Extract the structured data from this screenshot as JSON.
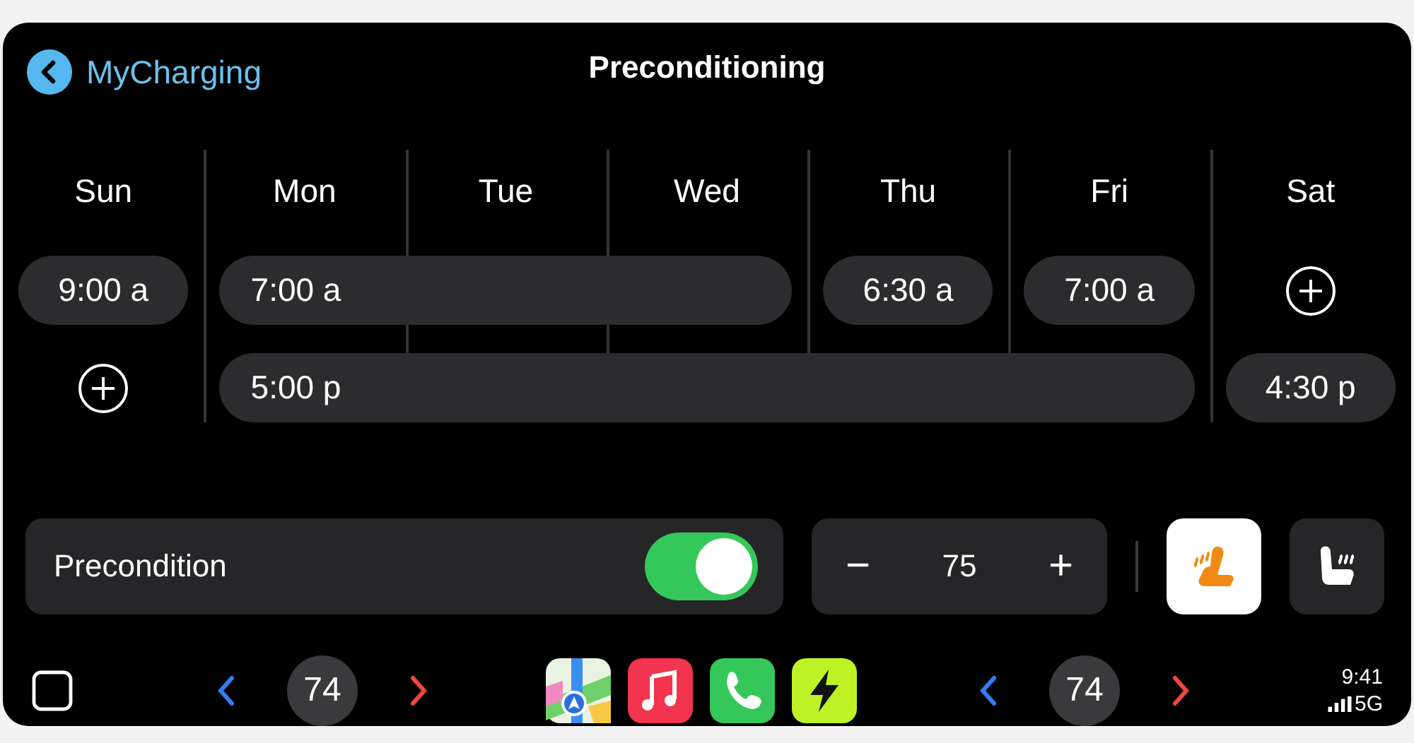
{
  "header": {
    "back_label": "MyCharging",
    "title": "Preconditioning"
  },
  "schedule": {
    "days": [
      "Sun",
      "Mon",
      "Tue",
      "Wed",
      "Thu",
      "Fri",
      "Sat"
    ],
    "rows": [
      {
        "cells": [
          {
            "kind": "time",
            "time": "9:00 a"
          },
          {
            "kind": "time",
            "time": "7:00 a"
          },
          {
            "kind": "continued"
          },
          {
            "kind": "continued"
          },
          {
            "kind": "time",
            "time": "6:30 a"
          },
          {
            "kind": "time",
            "time": "7:00 a"
          },
          {
            "kind": "add"
          }
        ]
      },
      {
        "cells": [
          {
            "kind": "add"
          },
          {
            "kind": "time",
            "time": "5:00 p"
          },
          {
            "kind": "continued"
          },
          {
            "kind": "continued"
          },
          {
            "kind": "continued"
          },
          {
            "kind": "continued"
          },
          {
            "kind": "time",
            "time": "4:30 p"
          }
        ]
      }
    ]
  },
  "precondition": {
    "label": "Precondition",
    "on": true
  },
  "temperature": {
    "minus": "−",
    "value": "75",
    "plus": "+"
  },
  "seat_buttons": [
    {
      "kind": "seat",
      "selected": true
    },
    {
      "kind": "back",
      "selected": false
    }
  ],
  "dock": {
    "left_temp": "74",
    "apps": [
      {
        "kind": "maps"
      },
      {
        "kind": "music"
      },
      {
        "kind": "phone"
      },
      {
        "kind": "charge"
      }
    ],
    "right_temp": "74",
    "time": "9:41",
    "network": "5G"
  }
}
